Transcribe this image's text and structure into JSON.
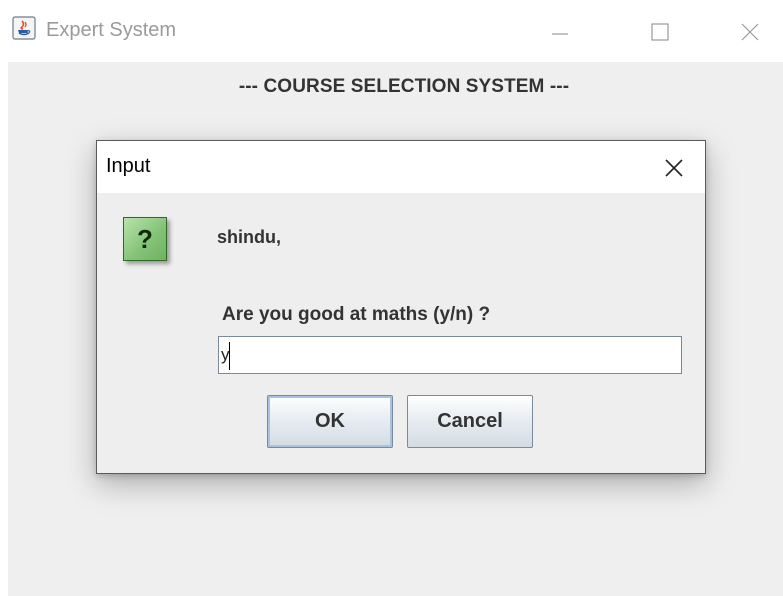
{
  "window": {
    "title": "Expert System",
    "app_icon": "java-coffee-icon",
    "controls": [
      "minimize-icon",
      "maximize-icon",
      "close-icon"
    ]
  },
  "main": {
    "header": "--- COURSE SELECTION SYSTEM ---"
  },
  "dialog": {
    "title": "Input",
    "icon": "question-icon",
    "icon_glyph": "?",
    "name_line": "shindu,",
    "question": "Are you good at maths (y/n) ?",
    "input_value": "y",
    "ok_label": "OK",
    "cancel_label": "Cancel"
  },
  "colors": {
    "content_background": "#efefef",
    "icon_green": "#86c479",
    "focus_ring": "#a8c3de"
  }
}
